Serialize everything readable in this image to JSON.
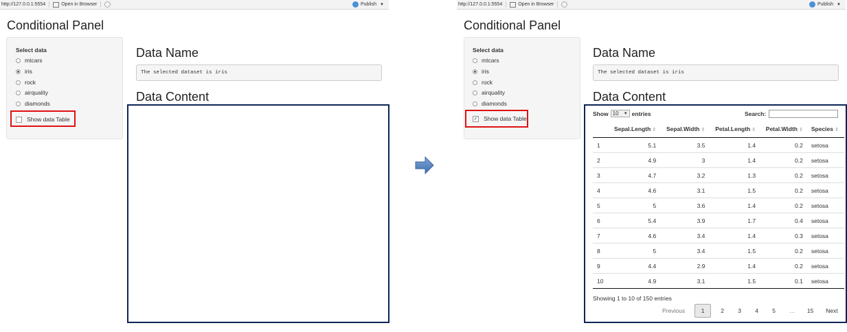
{
  "topbar": {
    "url": "http://127.0.0.1:5554",
    "open_in_browser": "Open in Browser",
    "publish": "Publish"
  },
  "app": {
    "title": "Conditional Panel",
    "select_label": "Select data",
    "datasets": [
      "mtcars",
      "iris",
      "rock",
      "airquality",
      "diamonds"
    ],
    "selected": "iris",
    "checkbox_label": "Show data Table",
    "data_name_heading": "Data Name",
    "selected_text": "The selected dataset is  iris",
    "data_content_heading": "Data Content"
  },
  "before": {
    "show_table_checked": false
  },
  "after": {
    "show_table_checked": true
  },
  "datatable": {
    "show": "Show",
    "page_length": "10",
    "entries": "entries",
    "search_label": "Search:",
    "columns": [
      "",
      "Sepal.Length",
      "Sepal.Width",
      "Petal.Length",
      "Petal.Width",
      "Species"
    ],
    "rows": [
      [
        "1",
        "5.1",
        "3.5",
        "1.4",
        "0.2",
        "setosa"
      ],
      [
        "2",
        "4.9",
        "3",
        "1.4",
        "0.2",
        "setosa"
      ],
      [
        "3",
        "4.7",
        "3.2",
        "1.3",
        "0.2",
        "setosa"
      ],
      [
        "4",
        "4.6",
        "3.1",
        "1.5",
        "0.2",
        "setosa"
      ],
      [
        "5",
        "5",
        "3.6",
        "1.4",
        "0.2",
        "setosa"
      ],
      [
        "6",
        "5.4",
        "3.9",
        "1.7",
        "0.4",
        "setosa"
      ],
      [
        "7",
        "4.6",
        "3.4",
        "1.4",
        "0.3",
        "setosa"
      ],
      [
        "8",
        "5",
        "3.4",
        "1.5",
        "0.2",
        "setosa"
      ],
      [
        "9",
        "4.4",
        "2.9",
        "1.4",
        "0.2",
        "setosa"
      ],
      [
        "10",
        "4.9",
        "3.1",
        "1.5",
        "0.1",
        "setosa"
      ]
    ],
    "info": "Showing 1 to 10 of 150 entries",
    "pager": {
      "previous": "Previous",
      "pages": [
        "1",
        "2",
        "3",
        "4",
        "5",
        "…",
        "15"
      ],
      "next": "Next"
    }
  },
  "colors": {
    "highlight_red": "#e01010",
    "frame_navy": "#0b2456",
    "arrow_blue": "#4f81bd"
  }
}
